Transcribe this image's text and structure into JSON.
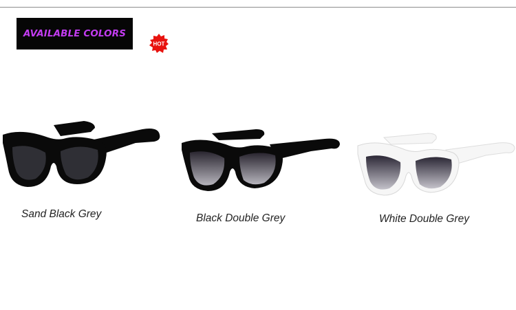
{
  "banner": {
    "label": "AVAILABLE COLORS",
    "text_color": "#c23cf0",
    "background": "#060606"
  },
  "badge": {
    "label": "HOT",
    "color": "#e8130f"
  },
  "products": [
    {
      "caption": "Sand Black Grey",
      "frame_color": "#0a0a0a",
      "lens_color": "#2f2f35"
    },
    {
      "caption": "Black Double Grey",
      "frame_color": "#0a0a0a",
      "lens_color": "#3a3645"
    },
    {
      "caption": "White Double Grey",
      "frame_color": "#f6f6f6",
      "lens_color": "#3c3848"
    }
  ]
}
